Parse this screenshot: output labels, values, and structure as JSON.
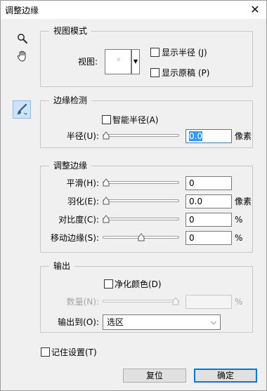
{
  "window": {
    "title": "调整边缘",
    "close_glyph": "✕"
  },
  "tools": [
    {
      "name": "zoom-tool",
      "icon": "magnifier-icon"
    },
    {
      "name": "hand-tool",
      "icon": "hand-icon"
    },
    {
      "name": "refine-radius-tool",
      "icon": "brush-icon"
    }
  ],
  "view_mode": {
    "legend": "视图模式",
    "view_label": "视图:",
    "show_radius": "显示半径 (J)",
    "show_original": "显示原稿 (P)"
  },
  "edge_detection": {
    "legend": "边缘检测",
    "smart_radius": "智能半径(A)",
    "radius_label": "半径(U):",
    "radius_value": "0.0",
    "radius_unit": "像素",
    "radius_level": 0
  },
  "adjust_edge": {
    "legend": "调整边缘",
    "smooth_label": "平滑(H):",
    "smooth_value": "0",
    "feather_label": "羽化(E):",
    "feather_value": "0.0",
    "feather_unit": "像素",
    "contrast_label": "对比度(C):",
    "contrast_value": "0",
    "contrast_unit": "%",
    "shift_label": "移动边缘(S):",
    "shift_value": "0",
    "shift_unit": "%",
    "shift_level": 0.5
  },
  "output": {
    "legend": "输出",
    "decontaminate": "净化颜色(D)",
    "amount_label": "数量(N):",
    "amount_unit": "%",
    "output_to_label": "输出到(O):",
    "output_to_value": "选区"
  },
  "remember": "记住设置(T)",
  "buttons": {
    "reset": "复位",
    "ok": "确定"
  },
  "colors": {
    "accent": "#0078d7",
    "active_tool": "#cfe3f6"
  }
}
